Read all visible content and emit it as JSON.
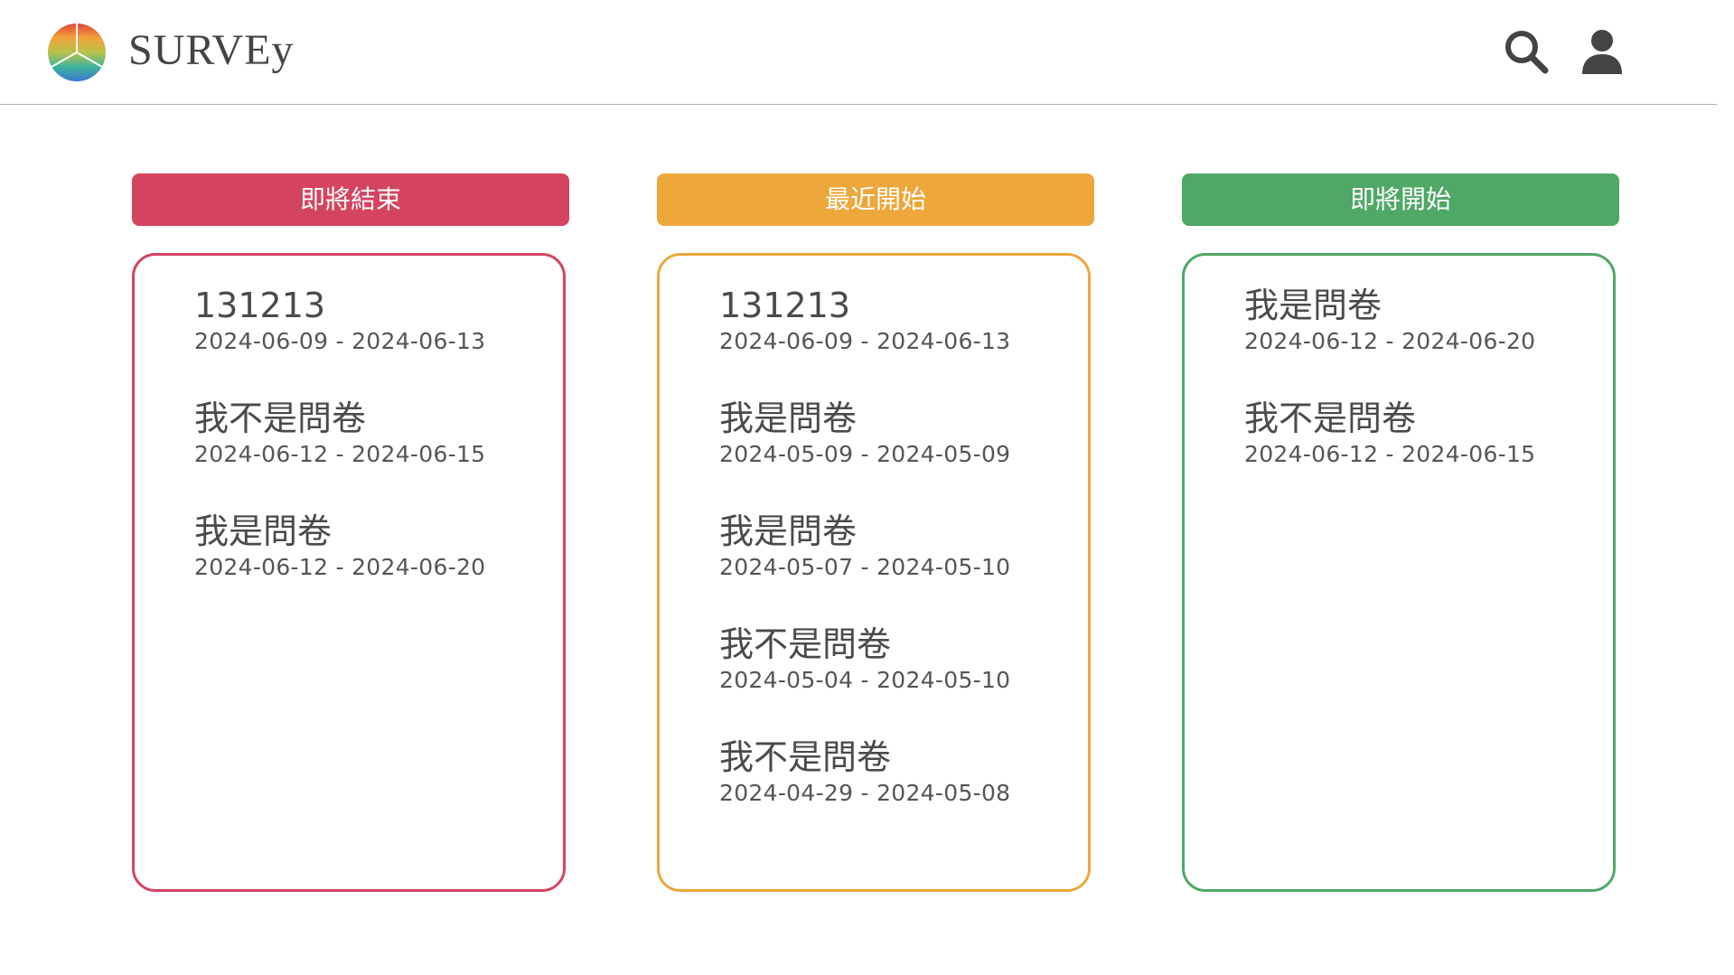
{
  "header": {
    "brand": "SURVEy"
  },
  "icons": {
    "logo": "rainbow-circle-logo",
    "search": "search-icon",
    "user": "user-icon"
  },
  "colors": {
    "ending_soon": "#d4445f",
    "recently_started": "#eda73a",
    "starting_soon": "#4fa865"
  },
  "columns": [
    {
      "label": "即將結束",
      "items": [
        {
          "title": "131213",
          "dates": "2024-06-09 - 2024-06-13"
        },
        {
          "title": "我不是問卷",
          "dates": "2024-06-12 - 2024-06-15"
        },
        {
          "title": "我是問卷",
          "dates": "2024-06-12 - 2024-06-20"
        }
      ]
    },
    {
      "label": "最近開始",
      "items": [
        {
          "title": "131213",
          "dates": "2024-06-09 - 2024-06-13"
        },
        {
          "title": "我是問卷",
          "dates": "2024-05-09 - 2024-05-09"
        },
        {
          "title": "我是問卷",
          "dates": "2024-05-07 - 2024-05-10"
        },
        {
          "title": "我不是問卷",
          "dates": "2024-05-04 - 2024-05-10"
        },
        {
          "title": "我不是問卷",
          "dates": "2024-04-29 - 2024-05-08"
        }
      ]
    },
    {
      "label": "即將開始",
      "items": [
        {
          "title": "我是問卷",
          "dates": "2024-06-12 - 2024-06-20"
        },
        {
          "title": "我不是問卷",
          "dates": "2024-06-12 - 2024-06-15"
        }
      ]
    }
  ]
}
